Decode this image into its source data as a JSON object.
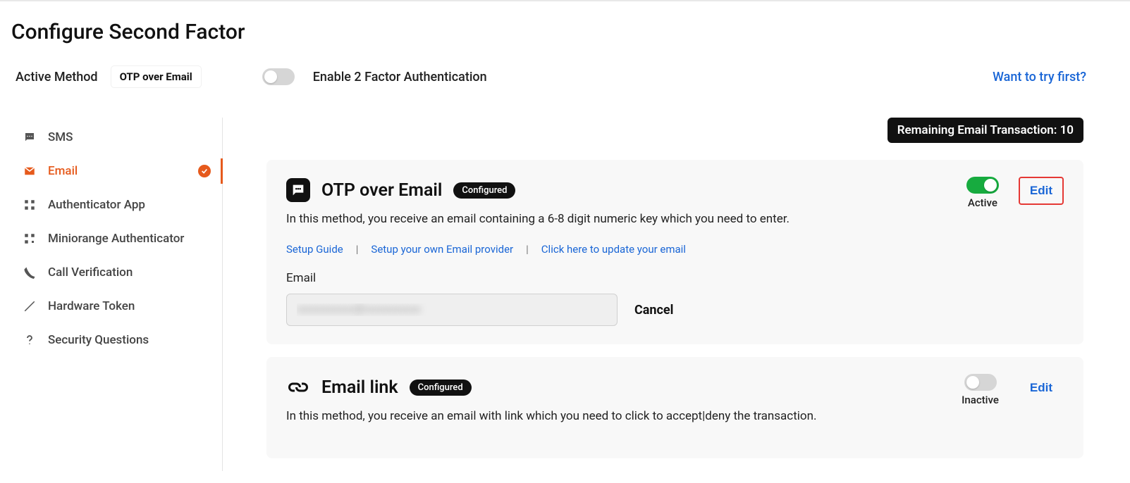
{
  "page_title": "Configure Second Factor",
  "header": {
    "active_method_label": "Active Method",
    "active_method_value": "OTP over Email",
    "enable_label": "Enable 2 Factor Authentication",
    "try_link": "Want to try first?"
  },
  "sidebar": {
    "items": [
      {
        "label": "SMS",
        "icon": "sms-icon"
      },
      {
        "label": "Email",
        "icon": "email-icon"
      },
      {
        "label": "Authenticator App",
        "icon": "authenticator-icon"
      },
      {
        "label": "Miniorange Authenticator",
        "icon": "miniorange-icon"
      },
      {
        "label": "Call Verification",
        "icon": "call-icon"
      },
      {
        "label": "Hardware Token",
        "icon": "hardware-icon"
      },
      {
        "label": "Security Questions",
        "icon": "question-icon"
      }
    ]
  },
  "remaining_label": "Remaining Email Transaction: 10",
  "cards": {
    "otp_email": {
      "title": "OTP over Email",
      "configured_label": "Configured",
      "desc": "In this method, you receive an email containing a 6-8 digit numeric key which you need to enter.",
      "toggle_state": "Active",
      "edit_label": "Edit",
      "links": {
        "setup_guide": "Setup Guide",
        "setup_provider": "Setup your own Email provider",
        "update_email": "Click here to update your email"
      },
      "email_field_label": "Email",
      "email_value": "xxxxxxxxxx@xxxxxxxxxx",
      "cancel_label": "Cancel"
    },
    "email_link": {
      "title": "Email link",
      "configured_label": "Configured",
      "desc": "In this method, you receive an email with link which you need to click to accept|deny the transaction.",
      "toggle_state": "Inactive",
      "edit_label": "Edit"
    }
  }
}
